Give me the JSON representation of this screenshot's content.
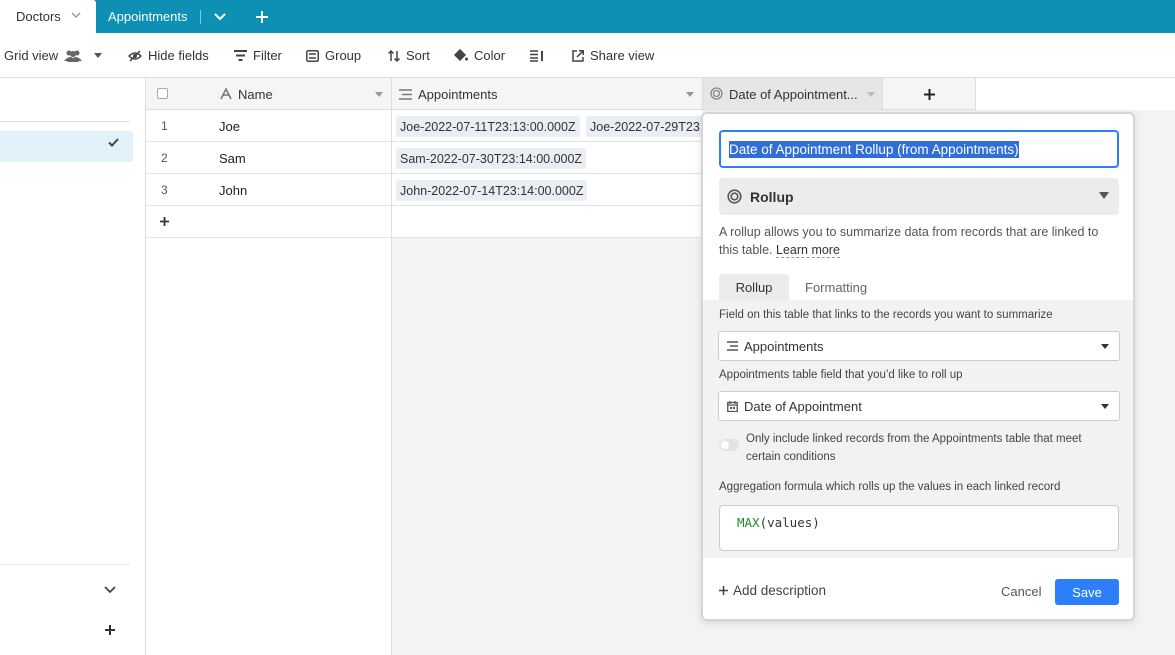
{
  "tabs": {
    "active": "Doctors",
    "second": "Appointments"
  },
  "toolbar": {
    "view_name": "Grid view",
    "hide_fields": "Hide fields",
    "filter": "Filter",
    "group": "Group",
    "sort": "Sort",
    "color": "Color",
    "share_view": "Share view"
  },
  "grid": {
    "columns": [
      "Name",
      "Appointments",
      "Date of Appointment..."
    ],
    "add_row": "+",
    "add_column": "+",
    "rows": [
      {
        "num": "1",
        "name": "Joe",
        "appointments": [
          "Joe-2022-07-11T23:13:00.000Z",
          "Joe-2022-07-29T23"
        ]
      },
      {
        "num": "2",
        "name": "Sam",
        "appointments": [
          "Sam-2022-07-30T23:14:00.000Z"
        ]
      },
      {
        "num": "3",
        "name": "John",
        "appointments": [
          "John-2022-07-14T23:14:00.000Z"
        ]
      }
    ]
  },
  "popup": {
    "field_name": "Date of Appointment Rollup (from Appointments)",
    "field_type": "Rollup",
    "description": "A rollup allows you to summarize data from records that are linked to this table.",
    "learn_more": "Learn more",
    "tab_rollup": "Rollup",
    "tab_formatting": "Formatting",
    "link_field_label": "Field on this table that links to the records you want to summarize",
    "link_field_value": "Appointments",
    "rollup_field_label": "Appointments table field that you’d like to roll up",
    "rollup_field_value": "Date of Appointment",
    "condition_toggle_label": "Only include linked records from the Appointments table that meet certain conditions",
    "aggregation_label": "Aggregation formula which rolls up the values in each linked record",
    "formula_fn": "MAX",
    "formula_args": "(values)",
    "add_description": "Add description",
    "cancel": "Cancel",
    "save": "Save"
  },
  "colors": {
    "tabbar": "#0e90b4",
    "primary": "#2d7ff9",
    "selected_row": "#e1f2fb"
  }
}
